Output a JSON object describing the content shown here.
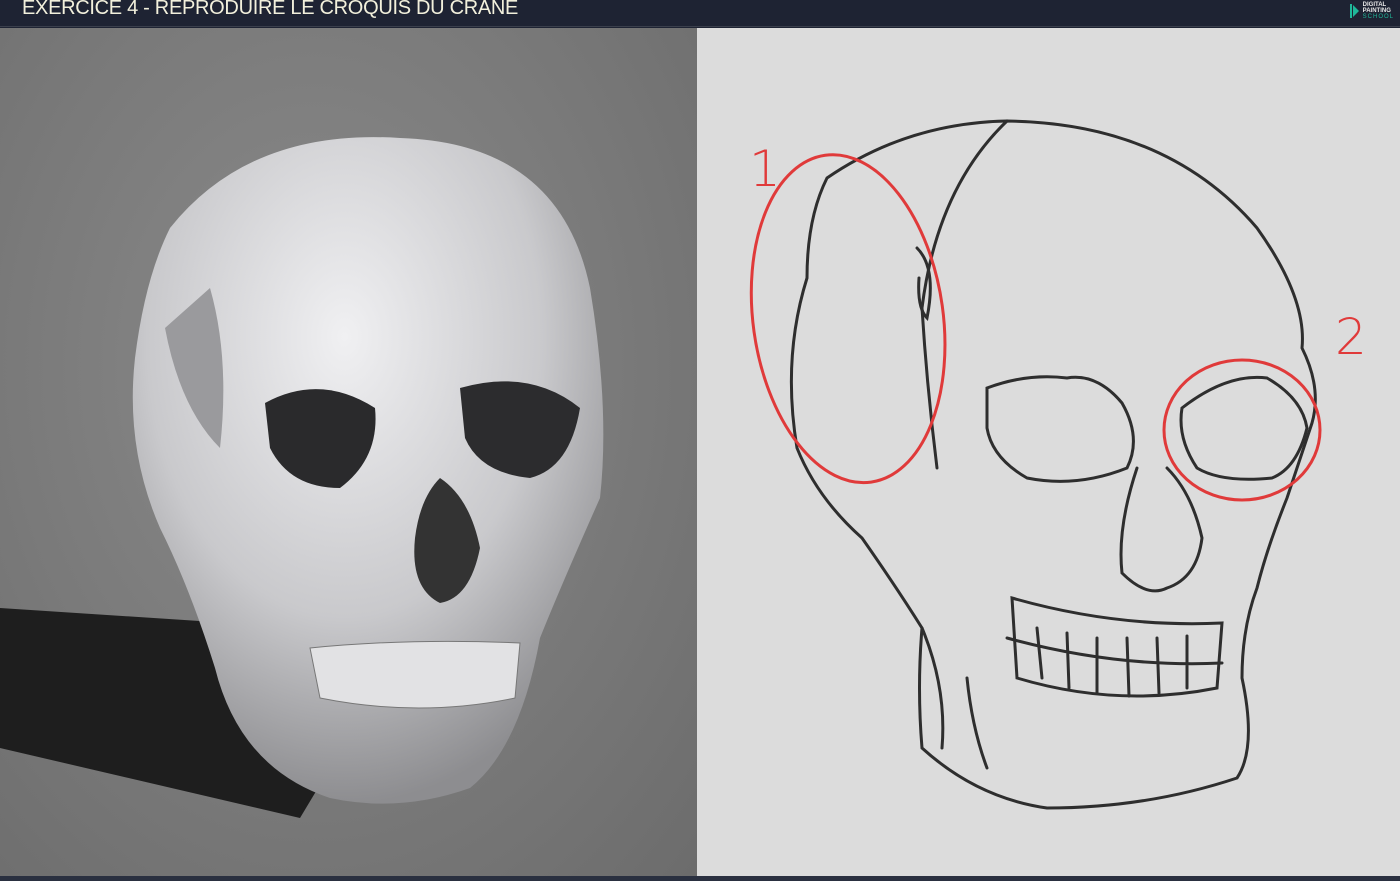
{
  "header": {
    "title": "EXERCICE 4 - REPRODUIRE LE CROQUIS DU CRANE",
    "logo": {
      "line1": "DIGITAL",
      "line2": "PAINTING",
      "line3": "SCHOOL"
    }
  },
  "annotations": {
    "mark1": "1",
    "mark2": "2",
    "color": "#e03a3a"
  },
  "colors": {
    "header": "#1e2333",
    "sketch_bg": "#dcdcdc",
    "sketch_line": "#2e2e2e"
  }
}
